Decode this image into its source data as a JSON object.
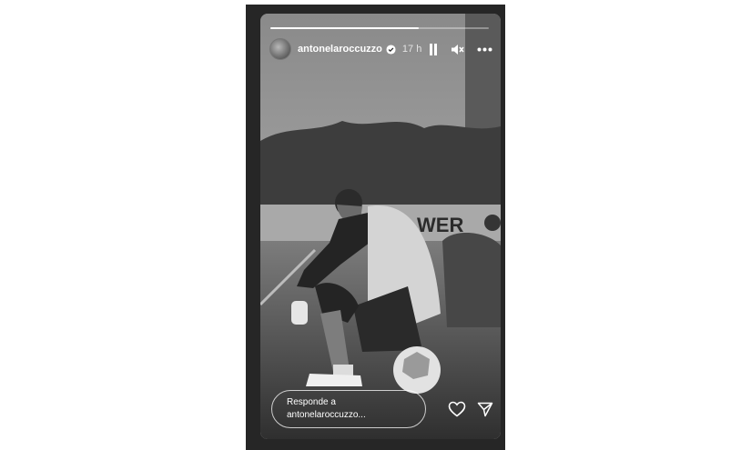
{
  "story": {
    "progress": 0.68,
    "user": {
      "username": "antonelaroccuzzo",
      "verified": true,
      "time": "17 h"
    },
    "controls": {
      "icons": [
        "pause-icon",
        "muted-speaker-icon",
        "more-icon"
      ]
    },
    "reply": {
      "line1": "Responde a",
      "line2": "antonelaroccuzzo..."
    },
    "actions": {
      "icons": [
        "heart-icon",
        "send-icon"
      ]
    },
    "image": {
      "jersey_text": "WER"
    }
  }
}
